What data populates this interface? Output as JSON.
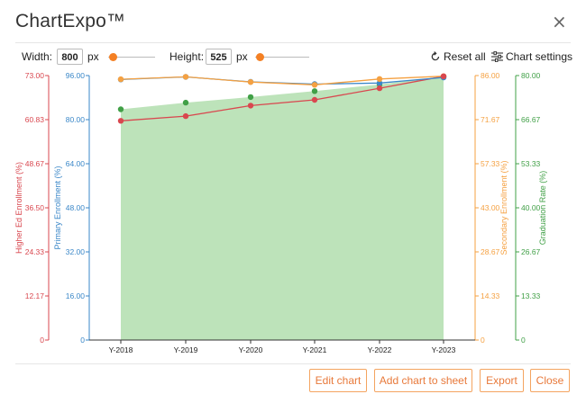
{
  "dialog": {
    "title": "ChartExpo™",
    "close_glyph": "×"
  },
  "toolbar": {
    "width_label": "Width:",
    "width_value": "800",
    "width_unit": "px",
    "height_label": "Height:",
    "height_value": "525",
    "height_unit": "px",
    "reset_label": "Reset all",
    "settings_label": "Chart settings"
  },
  "footer": {
    "edit_label": "Edit chart",
    "add_label": "Add chart to sheet",
    "export_label": "Export",
    "close_label": "Close"
  },
  "colors": {
    "higher_ed": "#d9474f",
    "primary": "#3a87c8",
    "secondary": "#f5a142",
    "graduation": "#41a047",
    "area_fill": "#bde3ba",
    "accent": "#f48024"
  },
  "chart_data": {
    "type": "line",
    "categories": [
      "Y-2018",
      "Y-2019",
      "Y-2020",
      "Y-2021",
      "Y-2022",
      "Y-2023"
    ],
    "axes": [
      {
        "id": "higher_ed",
        "side": "left-outer",
        "label": "Higher Ed Enrollment (%)",
        "range": [
          0,
          73
        ],
        "ticks": [
          "0",
          "12.17",
          "24.33",
          "36.50",
          "48.67",
          "60.83",
          "73.00"
        ]
      },
      {
        "id": "primary",
        "side": "left-inner",
        "label": "Primary Enrollment (%)",
        "range": [
          0,
          96
        ],
        "ticks": [
          "0",
          "16.00",
          "32.00",
          "48.00",
          "64.00",
          "80.00",
          "96.00"
        ]
      },
      {
        "id": "secondary",
        "side": "right-inner",
        "label": "Secondary Enrollment (%)",
        "range": [
          0,
          86
        ],
        "ticks": [
          "0",
          "14.33",
          "28.67",
          "43.00",
          "57.33",
          "71.67",
          "86.00"
        ]
      },
      {
        "id": "graduation",
        "side": "right-outer",
        "label": "Graduation Rate (%)",
        "range": [
          0,
          80
        ],
        "ticks": [
          "0",
          "13.33",
          "26.67",
          "40.00",
          "53.33",
          "66.67",
          "80.00"
        ]
      }
    ],
    "series": [
      {
        "name": "Higher Ed Enrollment (%)",
        "axis": "higher_ed",
        "style": "line",
        "values": [
          60.5,
          61.8,
          64.7,
          66.3,
          69.5,
          72.8
        ]
      },
      {
        "name": "Primary Enrollment (%)",
        "axis": "primary",
        "style": "line",
        "values": [
          94.6,
          95.5,
          93.7,
          92.9,
          93.3,
          95.3
        ]
      },
      {
        "name": "Secondary Enrollment (%)",
        "axis": "secondary",
        "style": "line",
        "values": [
          84.8,
          85.6,
          83.9,
          83.0,
          84.9,
          85.8
        ]
      },
      {
        "name": "Graduation Rate (%)",
        "axis": "graduation",
        "style": "area",
        "values": [
          69.8,
          71.8,
          73.5,
          75.3,
          77.3,
          79.7
        ]
      }
    ]
  }
}
